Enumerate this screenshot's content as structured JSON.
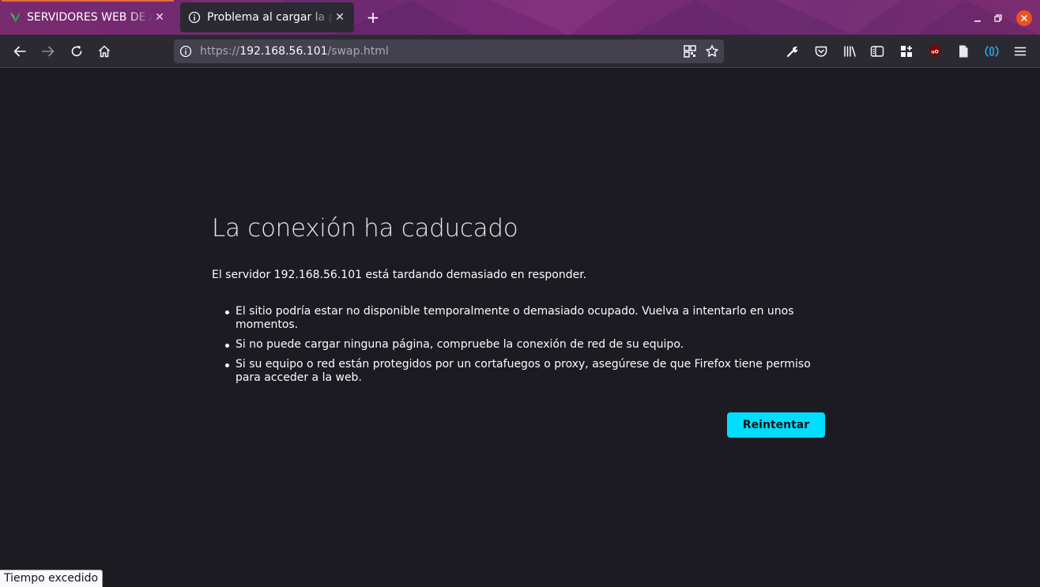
{
  "tabs": [
    {
      "label": "SERVIDORES WEB DE AL",
      "icon": "leaf-icon",
      "active": false
    },
    {
      "label": "Problema al cargar la página",
      "icon": "info-icon",
      "active": true
    }
  ],
  "tab_close_glyph": "✕",
  "new_tab_glyph": "+",
  "url": {
    "scheme": "https://",
    "host": "192.168.56.101",
    "path": "/swap.html"
  },
  "error": {
    "title": "La conexión ha caducado",
    "description": "El servidor 192.168.56.101 está tardando demasiado en responder.",
    "bullets": [
      "El sitio podría estar no disponible temporalmente o demasiado ocupado. Vuelva a intentarlo en unos momentos.",
      "Si no puede cargar ninguna página, compruebe la conexión de red de su equipo.",
      "Si su equipo o red están protegidos por un cortafuegos o proxy, asegúrese de que Firefox tiene permiso para acceder a la web."
    ],
    "retry_label": "Reintentar"
  },
  "status_text": "Tiempo excedido",
  "colors": {
    "accent": "#00ddff",
    "tab_bar": "#7a2a6e",
    "window_close": "#e95420",
    "background": "#1c1b22"
  }
}
